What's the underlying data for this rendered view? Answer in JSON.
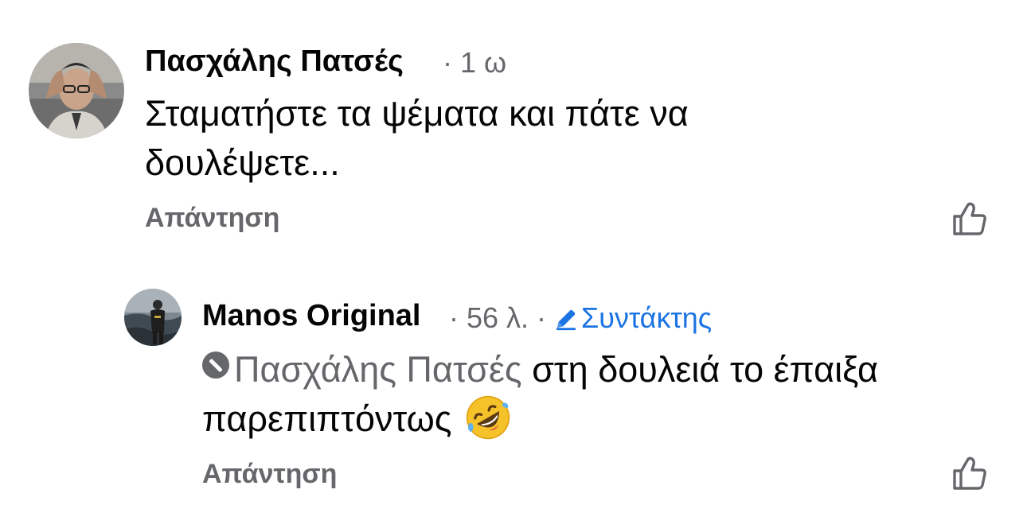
{
  "comments": [
    {
      "author": "Πασχάλης Πατσές",
      "time": " · 1 ω",
      "text": "Σταματήστε τα ψέματα και πάτε να δουλέψετε...",
      "reply_label": "Απάντηση",
      "avatar_icon": "profile-photo-man-holding-head"
    },
    {
      "author": "Manos Original",
      "time": " · 56 λ. · ",
      "badge": "Συντάκτης",
      "badge_icon": "pencil-icon",
      "mention": "Πασχάλης Πατσές",
      "text": " στη δουλειά το έπαιξα παρεπιπτόντως ",
      "emoji": "rolling-on-floor-laughing-emoji",
      "reply_label": "Απάντηση",
      "avatar_icon": "profile-photo-person-by-sea"
    }
  ],
  "colors": {
    "text": "#050505",
    "secondary": "#65676b",
    "editor_badge": "#1b74e4"
  }
}
